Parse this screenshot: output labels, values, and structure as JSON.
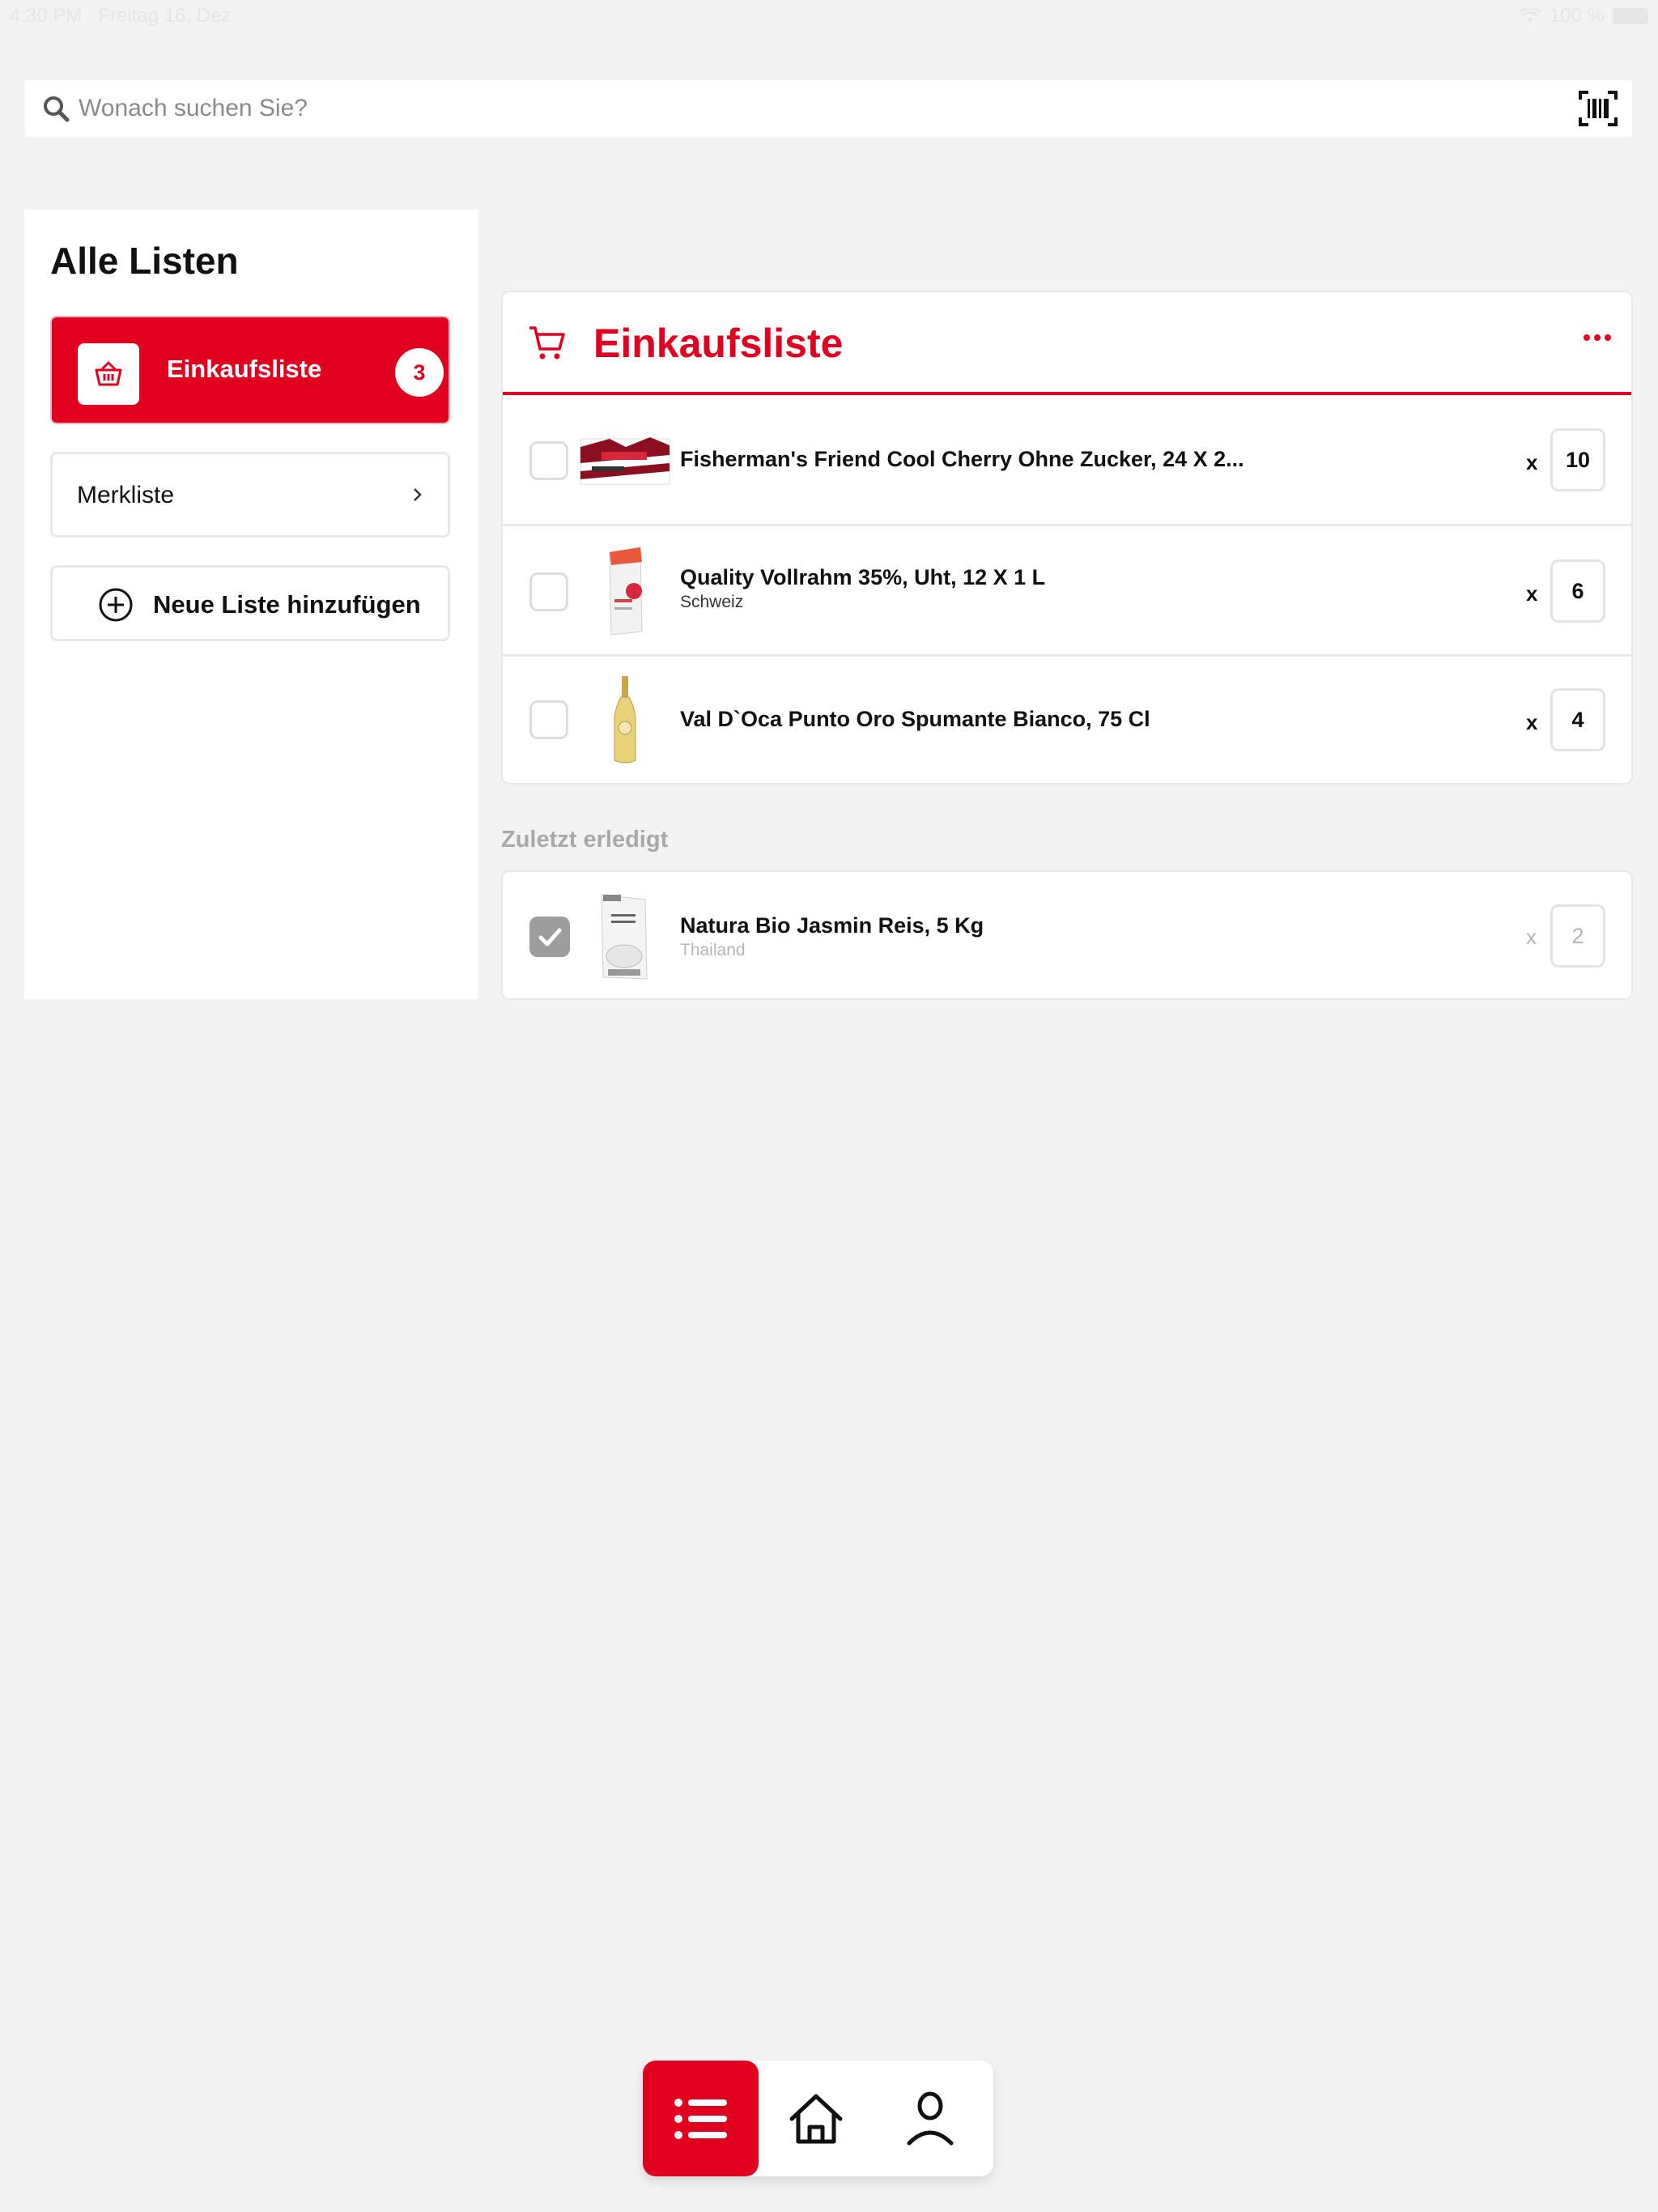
{
  "status_bar": {
    "time": "4:30 PM",
    "date": "Freitag 16. Dez",
    "battery": "100 %"
  },
  "search": {
    "placeholder": "Wonach suchen Sie?",
    "icon": "search-icon",
    "scan_icon": "barcode-scan-icon"
  },
  "sidebar": {
    "title": "Alle Listen",
    "active_list": {
      "label": "Einkaufsliste",
      "count": "3",
      "icon": "basket-icon"
    },
    "lists": [
      {
        "label": "Merkliste",
        "icon": "chevron-right-icon"
      }
    ],
    "add_button": {
      "label": "Neue Liste hinzufügen",
      "icon": "plus-circle-icon"
    }
  },
  "main": {
    "title": "Einkaufsliste",
    "header_icon": "cart-icon",
    "menu_icon": "more-icon",
    "items": [
      {
        "name": "Fisherman's Friend Cool Cherry Ohne Zucker, 24 X 2...",
        "origin": "",
        "times": "x",
        "qty": "10",
        "checked": false
      },
      {
        "name": "Quality Vollrahm 35%, Uht, 12 X 1 L",
        "origin": "Schweiz",
        "times": "x",
        "qty": "6",
        "checked": false
      },
      {
        "name": "Val D`Oca Punto Oro Spumante Bianco, 75 Cl",
        "origin": "",
        "times": "x",
        "qty": "4",
        "checked": false
      }
    ],
    "done_section": {
      "label": "Zuletzt erledigt",
      "items": [
        {
          "name": "Natura Bio Jasmin Reis, 5 Kg",
          "origin": "Thailand",
          "times": "x",
          "qty": "2",
          "checked": true
        }
      ]
    }
  },
  "tab_bar": {
    "tabs": [
      {
        "icon": "list-icon",
        "active": true
      },
      {
        "icon": "home-icon",
        "active": false
      },
      {
        "icon": "profile-icon",
        "active": false
      }
    ]
  },
  "colors": {
    "accent": "#e1001f",
    "background": "#f3f3f3",
    "muted_text": "#a9a9a9"
  }
}
